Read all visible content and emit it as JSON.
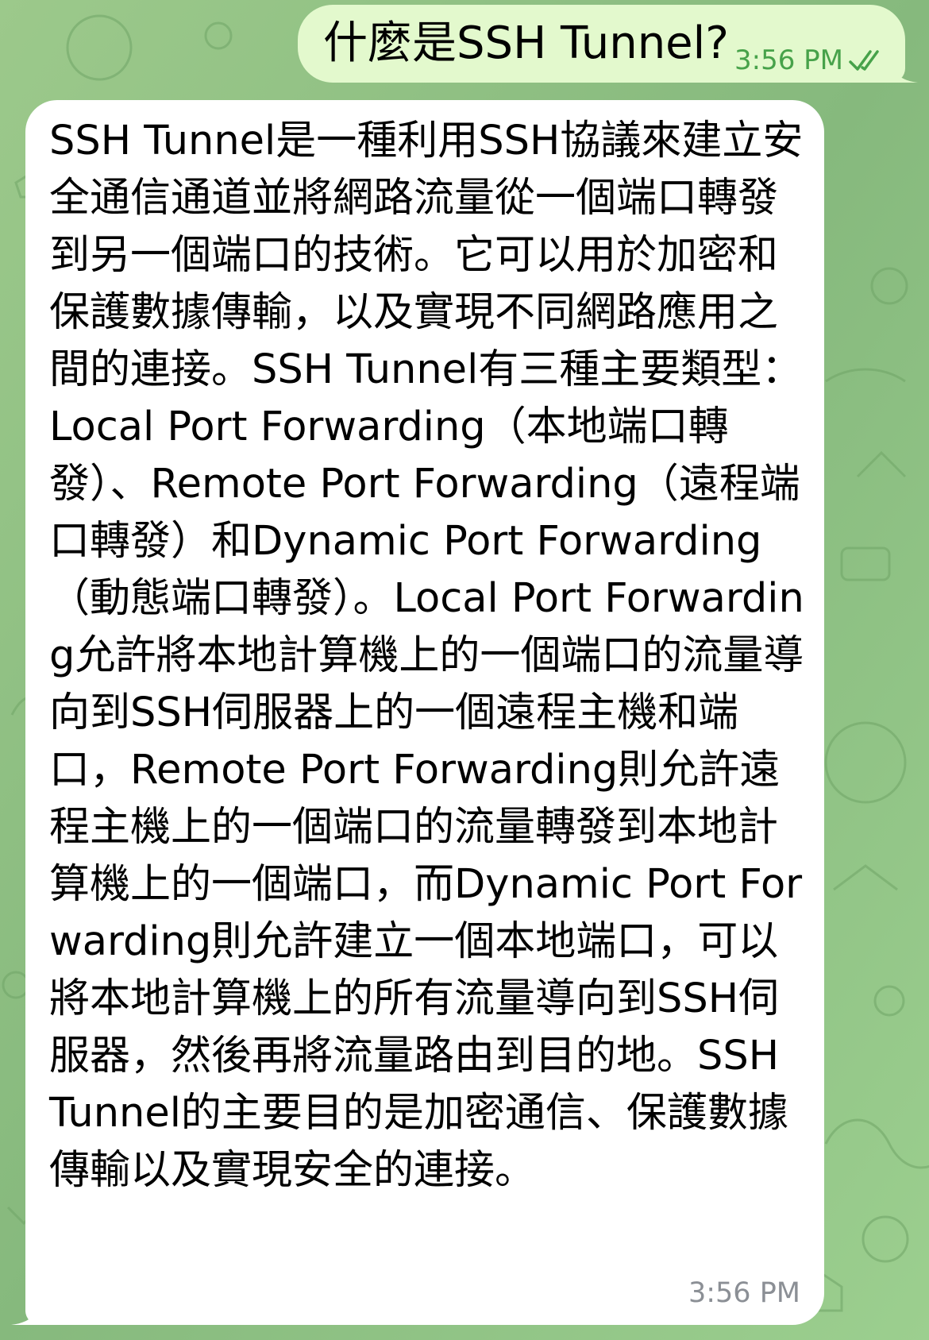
{
  "colors": {
    "background": "#8fbf85",
    "outgoing_bubble": "#e3f9cd",
    "incoming_bubble": "#ffffff",
    "outgoing_meta": "#47a24a",
    "incoming_meta": "#8b8f95"
  },
  "messages": [
    {
      "direction": "outgoing",
      "text": "什麼是SSH Tunnel?",
      "time": "3:56 PM",
      "status_icon": "double-check-icon"
    },
    {
      "direction": "incoming",
      "text": "SSH Tunnel是一種利用SSH協議來建立安全通信通道並將網路流量從一個端口轉發到另一個端口的技術。它可以用於加密和保護數據傳輸，以及實現不同網路應用之間的連接。SSH Tunnel有三種主要類型：Local Port Forwarding（本地端口轉發）、Remote Port Forwarding（遠程端口轉發）和Dynamic Port Forwarding（動態端口轉發）。Local Port Forwarding允許將本地計算機上的一個端口的流量導向到SSH伺服器上的一個遠程主機和端口，Remote Port Forwarding則允許遠程主機上的一個端口的流量轉發到本地計算機上的一個端口，而Dynamic Port Forwarding則允許建立一個本地端口，可以將本地計算機上的所有流量導向到SSH伺服器，然後再將流量路由到目的地。SSH Tunnel的主要目的是加密通信、保護數據傳輸以及實現安全的連接。",
      "time": "3:56 PM"
    }
  ]
}
